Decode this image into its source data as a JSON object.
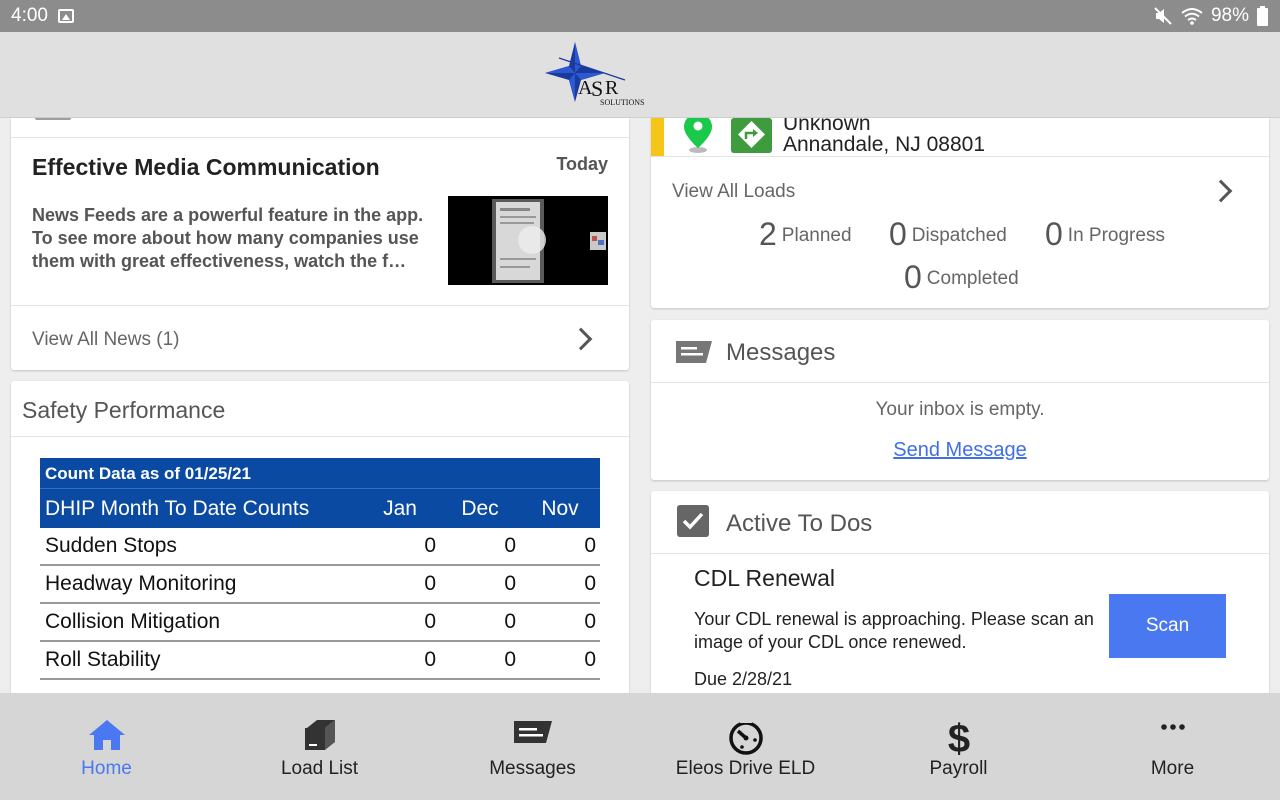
{
  "status_bar": {
    "time": "4:00",
    "battery": "98%"
  },
  "news": {
    "title": "Effective Media Communication",
    "date": "Today",
    "body": "News Feeds are a powerful feature in the app.  To see more about how many companies use them with great effectiveness, watch the f…",
    "view_all": "View All News (1)"
  },
  "safety": {
    "heading": "Safety Performance",
    "caption": "Count Data as of 01/25/21",
    "columns": [
      "DHIP Month To Date Counts",
      "Jan",
      "Dec",
      "Nov"
    ],
    "rows": [
      [
        "Sudden Stops",
        "0",
        "0",
        "0"
      ],
      [
        "Headway Monitoring",
        "0",
        "0",
        "0"
      ],
      [
        "Collision Mitigation",
        "0",
        "0",
        "0"
      ],
      [
        "Roll Stability",
        "0",
        "0",
        "0"
      ]
    ]
  },
  "loads": {
    "stop_name": "Unknown",
    "address": "Annandale, NJ 08801",
    "view_all": "View All Loads",
    "planned_count": "2",
    "planned_label": "Planned",
    "dispatched_count": "0",
    "dispatched_label": "Dispatched",
    "inprogress_count": "0",
    "inprogress_label": "In Progress",
    "completed_count": "0",
    "completed_label": "Completed"
  },
  "messages": {
    "heading": "Messages",
    "empty_text": "Your inbox is empty.",
    "send_link": "Send Message"
  },
  "todos": {
    "heading": "Active To Dos",
    "item_title": "CDL Renewal",
    "item_body": "Your CDL renewal is approaching.  Please scan an image of your CDL once renewed.",
    "scan_label": "Scan",
    "due": "Due 2/28/21"
  },
  "nav": {
    "home": "Home",
    "load_list": "Load List",
    "messages": "Messages",
    "eld": "Eleos Drive ELD",
    "payroll": "Payroll",
    "more": "More"
  },
  "colors": {
    "accent": "#4a78f0",
    "table_blue": "#0b4aa2",
    "status_yellow": "#f5c518",
    "green": "#3e9b3e"
  }
}
